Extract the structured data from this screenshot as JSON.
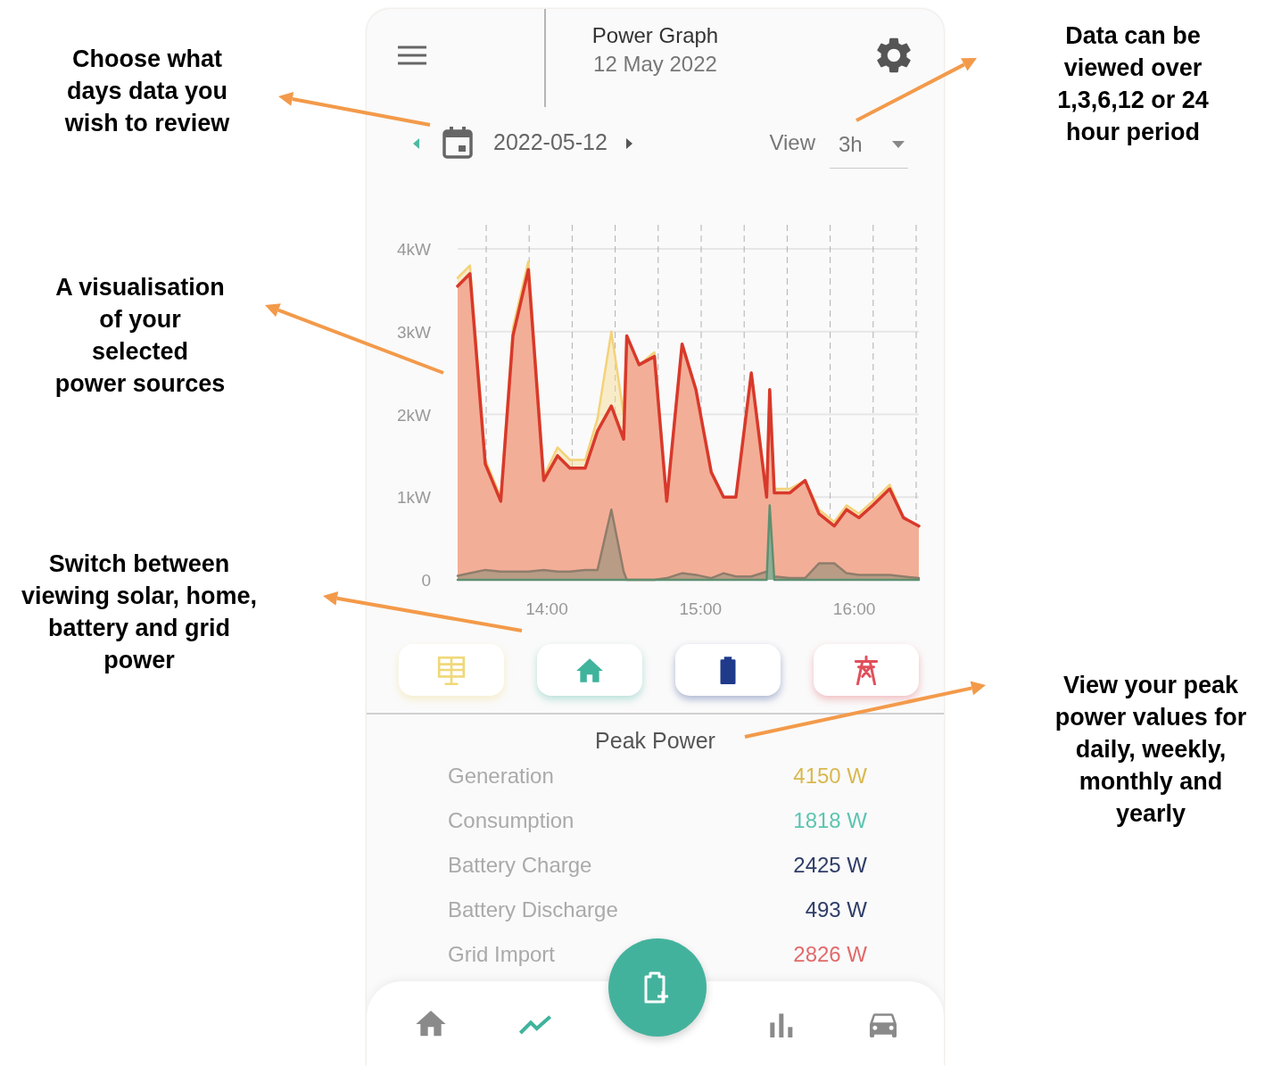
{
  "annotations": [
    {
      "text": "Choose what\ndays data you\nwish to review"
    },
    {
      "text": "Data can be\nviewed over\n1,3,6,12 or 24\nhour period"
    },
    {
      "text": "A visualisation\nof your\nselected\npower sources"
    },
    {
      "text": "Switch between\nviewing solar, home,\nbattery and grid\npower"
    },
    {
      "text": "View your peak\npower values for\ndaily, weekly,\nmonthly and\nyearly"
    }
  ],
  "header": {
    "title": "Power Graph",
    "subtitle": "12 May 2022"
  },
  "date_picker": {
    "date": "2022-05-12"
  },
  "view_select": {
    "label": "View",
    "value": "3h"
  },
  "chart": {
    "chart_data": {
      "type": "area",
      "x": [
        13.42,
        13.5,
        13.6,
        13.7,
        13.78,
        13.88,
        13.98,
        14.07,
        14.15,
        14.25,
        14.33,
        14.42,
        14.5,
        14.52,
        14.6,
        14.7,
        14.78,
        14.88,
        14.97,
        15.07,
        15.15,
        15.23,
        15.33,
        15.43,
        15.45,
        15.48,
        15.58,
        15.68,
        15.77,
        15.87,
        15.95,
        16.03,
        16.12,
        16.23,
        16.32,
        16.42
      ],
      "series": [
        {
          "color": "#f3d27a",
          "values": [
            3.65,
            3.8,
            1.45,
            1.0,
            3.05,
            3.85,
            1.25,
            1.6,
            1.45,
            1.45,
            1.95,
            3.0,
            2.0,
            2.95,
            2.6,
            2.75,
            0.95,
            2.85,
            2.3,
            1.3,
            1.0,
            1.0,
            2.5,
            1.05,
            2.3,
            1.1,
            1.1,
            1.2,
            0.85,
            0.7,
            0.9,
            0.8,
            0.95,
            1.15,
            0.75,
            0.65
          ]
        },
        {
          "color": "#d8392b",
          "values": [
            3.55,
            3.7,
            1.4,
            0.95,
            2.95,
            3.75,
            1.2,
            1.5,
            1.35,
            1.35,
            1.8,
            2.1,
            1.7,
            2.95,
            2.6,
            2.7,
            0.95,
            2.85,
            2.3,
            1.3,
            1.0,
            1.0,
            2.5,
            1.0,
            2.3,
            1.05,
            1.05,
            1.2,
            0.8,
            0.65,
            0.85,
            0.75,
            0.9,
            1.1,
            0.75,
            0.65
          ]
        },
        {
          "color": "#8f7d6c",
          "values": [
            0.05,
            0.08,
            0.12,
            0.1,
            0.1,
            0.1,
            0.12,
            0.1,
            0.1,
            0.12,
            0.12,
            0.85,
            0.1,
            0.0,
            0.0,
            0.0,
            0.02,
            0.08,
            0.06,
            0.02,
            0.08,
            0.04,
            0.04,
            0.1,
            0.1,
            0.04,
            0.02,
            0.02,
            0.2,
            0.2,
            0.08,
            0.06,
            0.06,
            0.06,
            0.04,
            0.02
          ]
        },
        {
          "color": "#5f8f70",
          "values": [
            0,
            0,
            0,
            0,
            0,
            0,
            0,
            0,
            0,
            0,
            0,
            0,
            0,
            0,
            0,
            0,
            0,
            0,
            0,
            0,
            0,
            0,
            0,
            0,
            0.9,
            0,
            0,
            0,
            0,
            0,
            0,
            0,
            0,
            0,
            0,
            0
          ]
        }
      ],
      "xlim": [
        13.42,
        16.42
      ],
      "ylim": [
        0,
        4.3
      ],
      "grid": true,
      "xticks": [
        {
          "value": 14,
          "label": "14:00"
        },
        {
          "value": 15,
          "label": "15:00"
        },
        {
          "value": 16,
          "label": "16:00"
        }
      ],
      "yticks": [
        {
          "value": 0,
          "label": "0"
        },
        {
          "value": 1,
          "label": "1kW"
        },
        {
          "value": 2,
          "label": "2kW"
        },
        {
          "value": 3,
          "label": "3kW"
        },
        {
          "value": 4,
          "label": "4kW"
        }
      ]
    }
  },
  "sources": [
    {
      "kind": "solar",
      "selected": true,
      "color": "#f0d879"
    },
    {
      "kind": "home",
      "selected": true,
      "color": "#3fb39c"
    },
    {
      "kind": "battery",
      "selected": true,
      "color": "#1f3a8a"
    },
    {
      "kind": "grid",
      "selected": true,
      "color": "#e0505a"
    }
  ],
  "peak_power": {
    "title": "Peak Power",
    "rows": [
      {
        "label": "Generation",
        "value": "4150 W",
        "color": "#d9b850"
      },
      {
        "label": "Consumption",
        "value": "1818 W",
        "color": "#5cc4b0"
      },
      {
        "label": "Battery Charge",
        "value": "2425 W",
        "color": "#2f3d68"
      },
      {
        "label": "Battery Discharge",
        "value": "493 W",
        "color": "#2f3d68"
      },
      {
        "label": "Grid Import",
        "value": "2826 W",
        "color": "#e26a6a"
      }
    ]
  },
  "bottom_nav": {
    "items": [
      {
        "kind": "home",
        "selected": false
      },
      {
        "kind": "trend",
        "selected": true
      },
      {
        "kind": "bar_chart",
        "selected": false
      },
      {
        "kind": "car",
        "selected": false
      }
    ]
  }
}
